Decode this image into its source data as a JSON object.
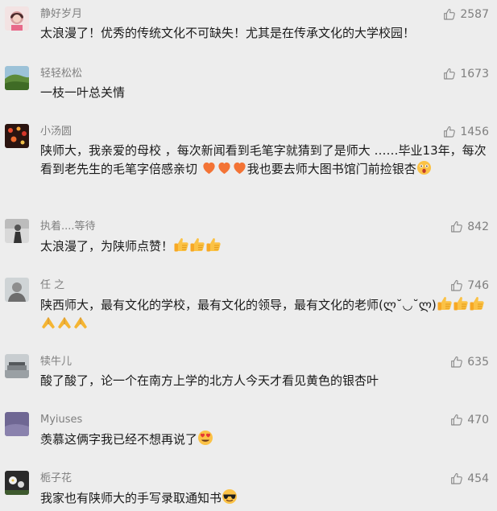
{
  "comments": [
    {
      "name": "静好岁月",
      "likes": "2587",
      "text": "太浪漫了！优秀的传统文化不可缺失！尤其是在传承文化的大学校园！",
      "text2": "",
      "avatar": "avatar-girl-pink"
    },
    {
      "name": "轻轻松松",
      "likes": "1673",
      "text": "一枝一叶总关情",
      "text2": "",
      "avatar": "avatar-green-hills"
    },
    {
      "name": "小汤圆",
      "likes": "1456",
      "text": "陕师大，我亲爱的母校 ，每次新闻看到毛笔字就猜到了是师大 ……毕业13年，每次看到老先生的毛笔字倍感亲切",
      "text2": "我也要去师大图书馆门前捡银杏",
      "avatar": "avatar-red-lights"
    },
    {
      "name": "执着....等待",
      "likes": "842",
      "text": "太浪漫了，为陕师点赞！",
      "text2": "",
      "avatar": "avatar-figure-gray"
    },
    {
      "name": "任 之",
      "likes": "746",
      "text": "陕西师大，最有文化的学校，最有文化的领导，最有文化的老师(ლ˘◡˘ლ)",
      "text2": "",
      "avatar": "avatar-man-gray"
    },
    {
      "name": "犊牛儿",
      "likes": "635",
      "text": "酸了酸了，论一个在南方上学的北方人今天才看见黄色的银杏叶",
      "text2": "",
      "avatar": "avatar-gray-building"
    },
    {
      "name": "Myiuses",
      "likes": "470",
      "text": "羡慕这俩字我已经不想再说了",
      "text2": "",
      "avatar": "avatar-purple"
    },
    {
      "name": "栀子花",
      "likes": "454",
      "text": "我家也有陕师大的手写录取通知书",
      "text2": "",
      "avatar": "avatar-dark-floral"
    }
  ],
  "icons": {
    "like": "thumb-up-outline-icon",
    "thumbs": "thumbs-up-emoji-icon",
    "heart": "orange-heart-emoji-icon",
    "pray": "folded-hands-emoji-icon",
    "astonished": "astonished-face-emoji-icon",
    "heart_eyes": "heart-eyes-emoji-icon",
    "sunglasses": "sunglasses-emoji-icon"
  },
  "colors": {
    "background": "#ededed",
    "name": "#7f7f7f",
    "text": "#1a1a1a",
    "like_icon": "#8a8a8a",
    "emoji_yellow": "#f5b533",
    "heart": "#f37335"
  }
}
